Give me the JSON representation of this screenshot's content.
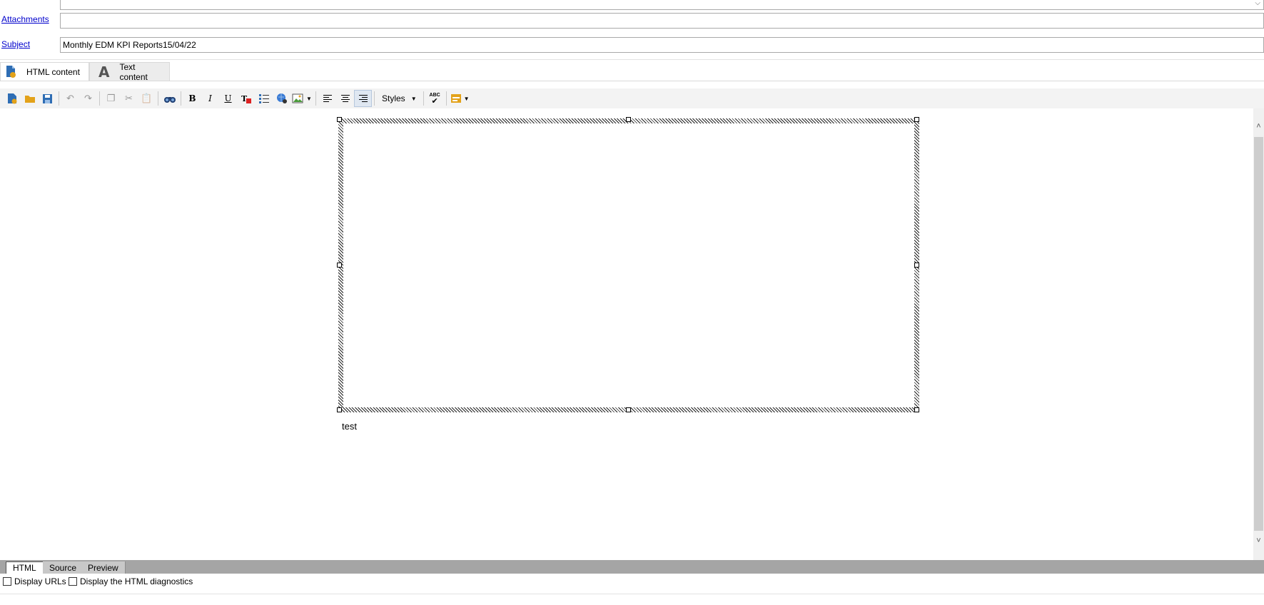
{
  "header": {
    "attachments_label": "Attachments",
    "attachments_value": "",
    "subject_label": "Subject",
    "subject_value": "Monthly EDM KPI Reports15/04/22"
  },
  "content_tabs": [
    {
      "label": "HTML content",
      "active": true
    },
    {
      "label": "Text content",
      "active": false
    }
  ],
  "toolbar": {
    "styles_label": "Styles",
    "spellcheck_text": "ABC"
  },
  "editor": {
    "body_text": "test"
  },
  "mode_tabs": [
    {
      "label": "HTML",
      "active": true
    },
    {
      "label": "Source",
      "active": false
    },
    {
      "label": "Preview",
      "active": false
    }
  ],
  "options": {
    "display_urls": "Display URLs",
    "display_diagnostics": "Display the HTML diagnostics"
  },
  "colors": {
    "link": "#0000cc",
    "folder": "#e3a21a",
    "save": "#2e6db4",
    "modebar": "#a5a5a5"
  }
}
